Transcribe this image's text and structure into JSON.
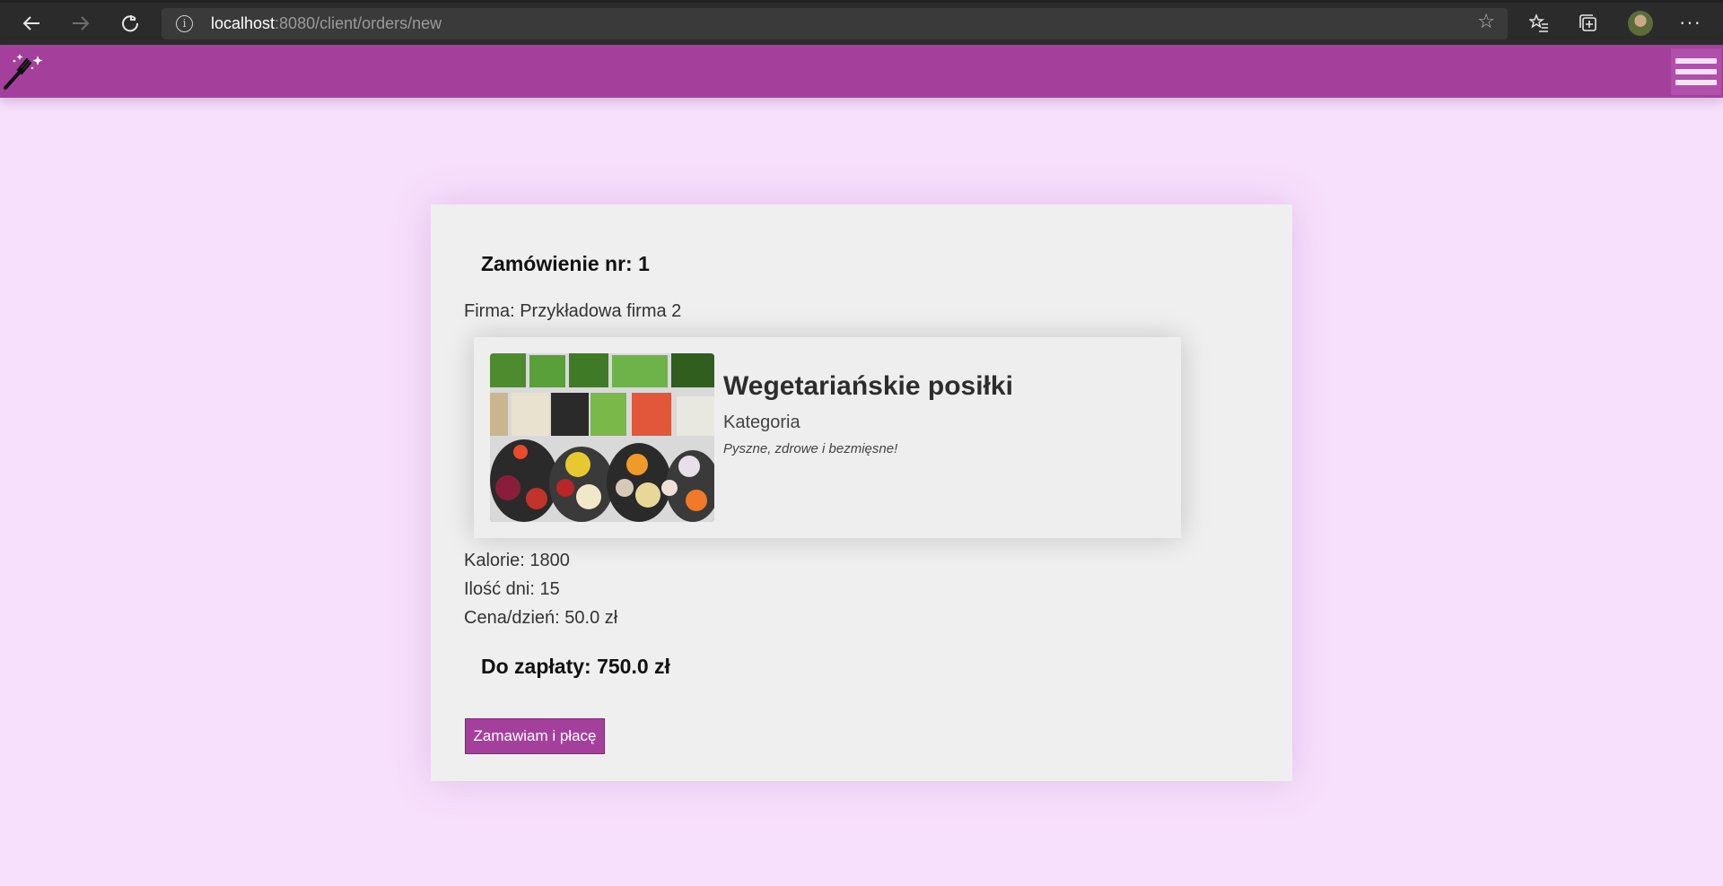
{
  "browser": {
    "url_host": "localhost",
    "url_rest": ":8080/client/orders/new",
    "icons": [
      "back-icon",
      "forward-icon",
      "refresh-icon",
      "info-icon",
      "star-icon",
      "favorites-icon",
      "collections-icon",
      "profile-avatar",
      "more-icon"
    ]
  },
  "app": {
    "accent_color": "#a4409c",
    "background_color": "#f7e0fc",
    "logo_icon": "magic-fork-icon",
    "menu_icon": "hamburger-icon"
  },
  "order": {
    "title": "Zamówienie nr: 1",
    "company": "Firma: Przykładowa firma 2",
    "product": {
      "name": "Wegetariańskie posiłki",
      "category": "Kategoria",
      "description": "Pyszne, zdrowe i bezmięsne!"
    },
    "calories": "Kalorie: 1800",
    "days": "Ilość dni: 15",
    "price_per_day": "Cena/dzień: 50.0 zł",
    "total": "Do zapłaty: 750.0 zł",
    "submit_label": "Zamawiam i płacę"
  }
}
